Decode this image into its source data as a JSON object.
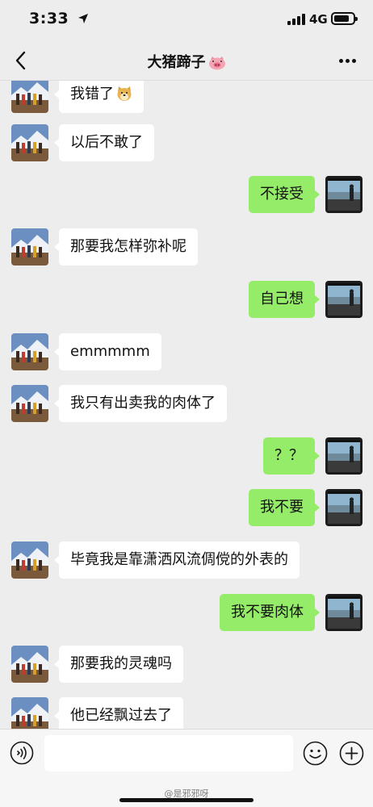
{
  "status_bar": {
    "time": "3:33",
    "network": "4G"
  },
  "nav": {
    "title": "大猪蹄子",
    "title_emoji_icon": "pig-face-icon",
    "back_icon": "chevron-left-icon",
    "more_icon": "more-dots-icon"
  },
  "messages": [
    {
      "side": "in",
      "text": "我错了",
      "emoji": "doge-emoji"
    },
    {
      "side": "in",
      "text": "以后不敢了"
    },
    {
      "side": "out",
      "text": "不接受"
    },
    {
      "side": "in",
      "text": "那要我怎样弥补呢"
    },
    {
      "side": "out",
      "text": "自己想"
    },
    {
      "side": "in",
      "text": "emmmmm"
    },
    {
      "side": "in",
      "text": "我只有出卖我的肉体了"
    },
    {
      "side": "out",
      "text": "？？"
    },
    {
      "side": "out",
      "text": "我不要"
    },
    {
      "side": "in",
      "text": "毕竟我是靠潇洒风流倜傥的外表的"
    },
    {
      "side": "out",
      "text": "我不要肉体"
    },
    {
      "side": "in",
      "text": "那要我的灵魂吗"
    },
    {
      "side": "in",
      "text": "他已经飘过去了"
    }
  ],
  "input_bar": {
    "placeholder": "",
    "voice_icon": "voice-icon",
    "emoji_icon": "smiley-icon",
    "plus_icon": "plus-circle-icon",
    "watermark": "@是邪邪呀"
  },
  "colors": {
    "background": "#ededed",
    "bubble_out": "#95ec69",
    "bubble_in": "#ffffff"
  }
}
